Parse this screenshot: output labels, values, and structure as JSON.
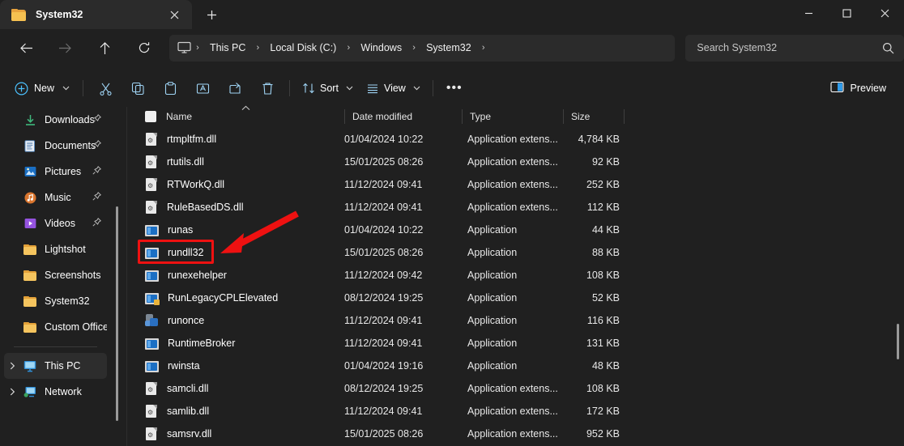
{
  "window": {
    "tab": {
      "title": "System32",
      "folder_icon": "folder-icon",
      "close_icon": "close-icon"
    },
    "new_tab_label": "+",
    "controls": {
      "minimize": "minimize-icon",
      "maximize": "maximize-icon",
      "close": "close-icon"
    }
  },
  "nav": {
    "back": "back-arrow-icon",
    "forward": "forward-arrow-icon",
    "up": "up-arrow-icon",
    "refresh": "refresh-icon",
    "breadcrumbs": [
      {
        "label": "This PC"
      },
      {
        "label": "Local Disk (C:)"
      },
      {
        "label": "Windows"
      },
      {
        "label": "System32"
      }
    ],
    "separator": "›"
  },
  "search": {
    "placeholder": "Search System32",
    "value": "Search System32",
    "icon": "search-icon"
  },
  "commandbar": {
    "new_label": "New",
    "chevron": "⌄",
    "cut": "cut-icon",
    "copy": "copy-icon",
    "paste": "paste-icon",
    "rename": "rename-icon",
    "share": "share-icon",
    "delete": "delete-icon",
    "sort_label": "Sort",
    "view_label": "View",
    "more_label": "•••",
    "preview_label": "Preview"
  },
  "sidebar": {
    "items": [
      {
        "label": "Downloads",
        "icon": "downloads-icon",
        "pinned": true
      },
      {
        "label": "Documents",
        "icon": "documents-icon",
        "pinned": true
      },
      {
        "label": "Pictures",
        "icon": "pictures-icon",
        "pinned": true
      },
      {
        "label": "Music",
        "icon": "music-icon",
        "pinned": true
      },
      {
        "label": "Videos",
        "icon": "videos-icon",
        "pinned": true
      },
      {
        "label": "Lightshot",
        "icon": "folder-icon",
        "pinned": false
      },
      {
        "label": "Screenshots",
        "icon": "folder-icon",
        "pinned": false
      },
      {
        "label": "System32",
        "icon": "folder-icon",
        "pinned": false
      },
      {
        "label": "Custom Office T",
        "icon": "folder-icon",
        "pinned": false
      }
    ],
    "tree": [
      {
        "label": "This PC",
        "icon": "this-pc-icon",
        "selected": true,
        "expander": "›"
      },
      {
        "label": "Network",
        "icon": "network-icon",
        "selected": false,
        "expander": "›"
      }
    ]
  },
  "filelist": {
    "columns": [
      {
        "key": "name",
        "label": "Name",
        "sorted": "asc"
      },
      {
        "key": "date",
        "label": "Date modified"
      },
      {
        "key": "type",
        "label": "Type"
      },
      {
        "key": "size",
        "label": "Size"
      }
    ],
    "sort_caret": "⌃",
    "rows": [
      {
        "name": "rtmpltfm.dll",
        "date": "01/04/2024 10:22",
        "type": "Application extens...",
        "size": "4,784 KB",
        "icon": "dll-file-icon"
      },
      {
        "name": "rtutils.dll",
        "date": "15/01/2025 08:26",
        "type": "Application extens...",
        "size": "92 KB",
        "icon": "dll-file-icon"
      },
      {
        "name": "RTWorkQ.dll",
        "date": "11/12/2024 09:41",
        "type": "Application extens...",
        "size": "252 KB",
        "icon": "dll-file-icon"
      },
      {
        "name": "RuleBasedDS.dll",
        "date": "11/12/2024 09:41",
        "type": "Application extens...",
        "size": "112 KB",
        "icon": "dll-file-icon"
      },
      {
        "name": "runas",
        "date": "01/04/2024 10:22",
        "type": "Application",
        "size": "44 KB",
        "icon": "application-icon"
      },
      {
        "name": "rundll32",
        "date": "15/01/2025 08:26",
        "type": "Application",
        "size": "88 KB",
        "icon": "application-icon"
      },
      {
        "name": "runexehelper",
        "date": "11/12/2024 09:42",
        "type": "Application",
        "size": "108 KB",
        "icon": "application-icon"
      },
      {
        "name": "RunLegacyCPLElevated",
        "date": "08/12/2024 19:25",
        "type": "Application",
        "size": "52 KB",
        "icon": "application-badge-icon"
      },
      {
        "name": "runonce",
        "date": "11/12/2024 09:41",
        "type": "Application",
        "size": "116 KB",
        "icon": "gear-application-icon"
      },
      {
        "name": "RuntimeBroker",
        "date": "11/12/2024 09:41",
        "type": "Application",
        "size": "131 KB",
        "icon": "application-icon"
      },
      {
        "name": "rwinsta",
        "date": "01/04/2024 19:16",
        "type": "Application",
        "size": "48 KB",
        "icon": "application-icon"
      },
      {
        "name": "samcli.dll",
        "date": "08/12/2024 19:25",
        "type": "Application extens...",
        "size": "108 KB",
        "icon": "dll-file-icon"
      },
      {
        "name": "samlib.dll",
        "date": "11/12/2024 09:41",
        "type": "Application extens...",
        "size": "172 KB",
        "icon": "dll-file-icon"
      },
      {
        "name": "samsrv.dll",
        "date": "15/01/2025 08:26",
        "type": "Application extens...",
        "size": "952 KB",
        "icon": "dll-file-icon"
      }
    ]
  },
  "annotation": {
    "highlight_target": "rundll32",
    "color": "#ee1111",
    "shapes": [
      "highlight-rectangle",
      "pointer-arrow"
    ]
  },
  "colors": {
    "background": "#202020",
    "surface": "#2b2b2b",
    "accent": "#4cc2ff",
    "annotation": "#ee1111",
    "folder": "#f5c45e"
  }
}
